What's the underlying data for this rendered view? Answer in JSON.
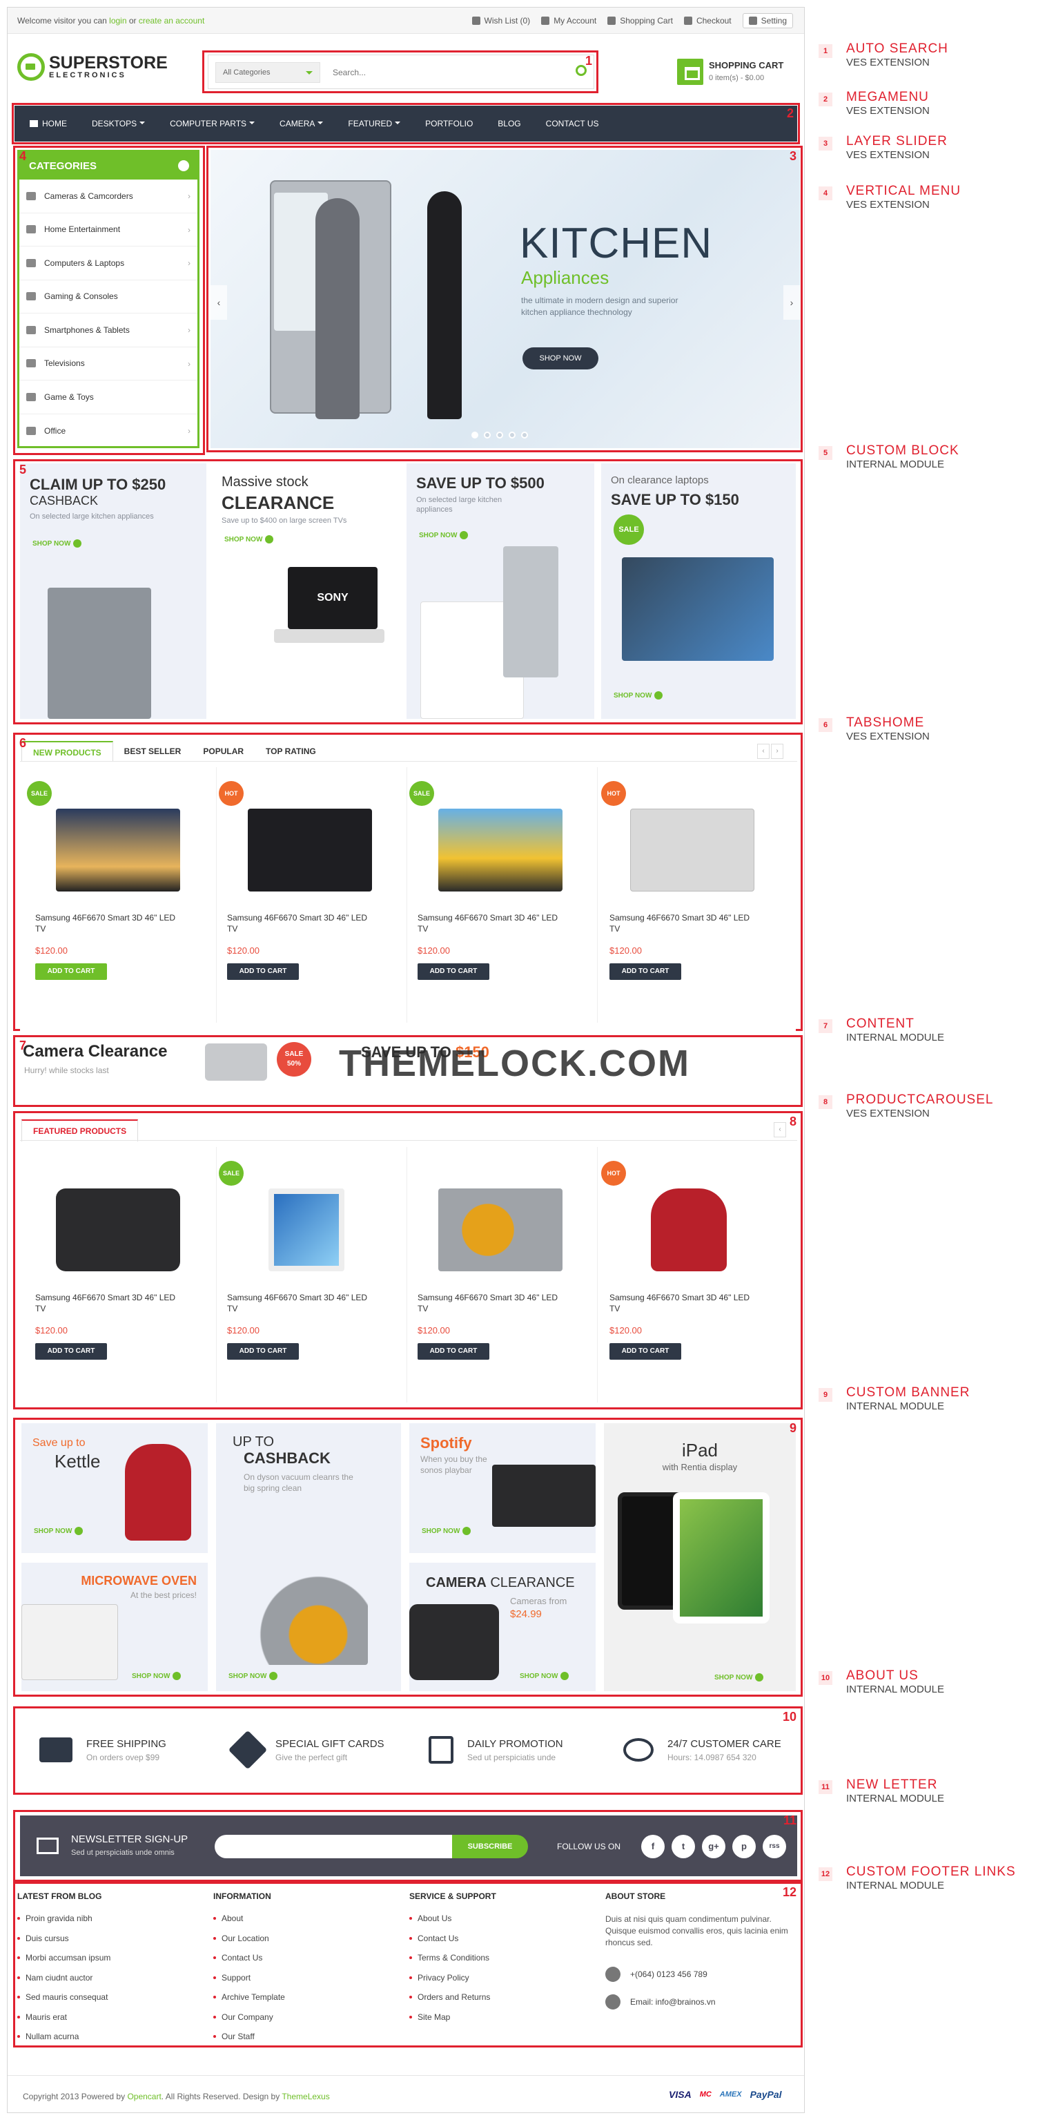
{
  "topbar": {
    "welcome_prefix": "Welcome visitor you can",
    "login": "login",
    "or": "or",
    "create": "create an account",
    "links": [
      "Wish List (0)",
      "My Account",
      "Shopping Cart",
      "Checkout"
    ],
    "setting": "Setting"
  },
  "logo": {
    "title": "SUPERSTORE",
    "subtitle": "ELECTRONICS"
  },
  "search": {
    "category": "All Categories",
    "placeholder": "Search..."
  },
  "cart": {
    "title": "SHOPPING CART",
    "summary": "0 item(s) - $0.00"
  },
  "nav": [
    "HOME",
    "DESKTOPS",
    "COMPUTER PARTS",
    "CAMERA",
    "FEATURED",
    "PORTFOLIO",
    "BLOG",
    "CONTACT US"
  ],
  "categories": {
    "title": "CATEGORIES",
    "items": [
      "Cameras & Camcorders",
      "Home Entertainment",
      "Computers & Laptops",
      "Gaming & Consoles",
      "Smartphones & Tablets",
      "Televisions",
      "Game & Toys",
      "Office"
    ]
  },
  "slider": {
    "title": "KITCHEN",
    "subtitle": "Appliances",
    "text": "the ultimate in modern design and superior kitchen appliance thechnology",
    "button": "SHOP NOW"
  },
  "custom_block": {
    "b1": {
      "line1": "CLAIM UP TO $250",
      "line2": "CASHBACK",
      "sub": "On selected large kitchen appliances",
      "shop": "SHOP NOW"
    },
    "b2": {
      "line1": "Massive stock",
      "line2": "CLEARANCE",
      "sub": "Save up to $400 on large screen TVs",
      "shop": "SHOP NOW",
      "brand": "SONY"
    },
    "b3": {
      "line1": "SAVE UP TO $500",
      "sub": "On selected large kitchen appliances",
      "shop": "SHOP NOW"
    },
    "b4": {
      "line1": "On clearance laptops",
      "line2": "SAVE UP TO $150",
      "badge": "SALE",
      "shop": "SHOP NOW"
    }
  },
  "tabs": [
    "NEW PRODUCTS",
    "BEST SELLER",
    "POPULAR",
    "TOP RATING"
  ],
  "products": [
    {
      "badge": "SALE",
      "name": "Samsung 46F6670 Smart 3D 46\" LED TV",
      "price": "$120.00",
      "button": "ADD TO CART"
    },
    {
      "badge": "HOT",
      "name": "Samsung 46F6670 Smart 3D 46\" LED TV",
      "price": "$120.00",
      "button": "ADD TO CART"
    },
    {
      "badge": "SALE",
      "name": "Samsung 46F6670 Smart 3D 46\" LED TV",
      "price": "$120.00",
      "button": "ADD TO CART"
    },
    {
      "badge": "HOT",
      "name": "Samsung 46F6670 Smart 3D 46\" LED TV",
      "price": "$120.00",
      "button": "ADD TO CART"
    }
  ],
  "content_block": {
    "title": "Camera Clearance",
    "sub": "Hurry! while stocks last",
    "sale": "SALE",
    "sale_pct": "50%",
    "save": "SAVE UP TO",
    "save_amt": "$150",
    "watermark": "THEMELOCK.COM"
  },
  "featured": {
    "tab": "FEATURED PRODUCTS",
    "items": [
      {
        "badge": "",
        "name": "Samsung 46F6670 Smart 3D 46\" LED TV",
        "price": "$120.00",
        "button": "ADD TO CART"
      },
      {
        "badge": "SALE",
        "name": "Samsung 46F6670 Smart 3D 46\" LED TV",
        "price": "$120.00",
        "button": "ADD TO CART"
      },
      {
        "badge": "",
        "name": "Samsung 46F6670 Smart 3D 46\" LED TV",
        "price": "$120.00",
        "button": "ADD TO CART"
      },
      {
        "badge": "HOT",
        "name": "Samsung 46F6670 Smart 3D 46\" LED TV",
        "price": "$120.00",
        "button": "ADD TO CART"
      }
    ]
  },
  "banners": {
    "kettle": {
      "l1": "Save up to",
      "l2": "Kettle",
      "shop": "SHOP NOW"
    },
    "microwave": {
      "l1": "MICROWAVE OVEN",
      "l2": "At the best prices!",
      "shop": "SHOP NOW"
    },
    "cashback": {
      "l1": "UP TO",
      "l2": "CASHBACK",
      "sub": "On dyson vacuum cleanrs the big spring clean",
      "shop": "SHOP NOW"
    },
    "spotify": {
      "l1": "Spotify",
      "sub": "When you buy the sonos playbar",
      "shop": "SHOP NOW"
    },
    "camera": {
      "l1": "CAMERA",
      "l2": "CLEARANCE",
      "sub": "Cameras from",
      "price": "$24.99",
      "shop": "SHOP NOW"
    },
    "ipad": {
      "l1": "iPad",
      "sub": "with Rentia display",
      "shop": "SHOP NOW"
    }
  },
  "about": [
    {
      "title": "FREE SHIPPING",
      "sub": "On orders ovep $99"
    },
    {
      "title": "SPECIAL GIFT CARDS",
      "sub": "Give the perfect gift"
    },
    {
      "title": "DAILY PROMOTION",
      "sub": "Sed ut perspiciatis unde"
    },
    {
      "title": "24/7 CUSTOMER CARE",
      "sub": "Hours: 14.0987 654 320"
    }
  ],
  "newsletter": {
    "title": "NEWSLETTER SIGN-UP",
    "sub": "Sed ut perspiciatis unde omnis",
    "button": "SUBSCRIBE",
    "follow": "FOLLOW US ON",
    "social": [
      "f",
      "t",
      "g+",
      "p",
      "rss"
    ]
  },
  "footer": {
    "blog": {
      "title": "LATEST FROM BLOG",
      "items": [
        "Proin gravida nibh",
        "Duis cursus",
        "Morbi accumsan ipsum",
        "Nam ciudnt auctor",
        "Sed mauris consequat",
        "Mauris erat",
        "Nullam acurna"
      ]
    },
    "info": {
      "title": "INFORMATION",
      "items": [
        "About",
        "Our Location",
        "Contact Us",
        "Support",
        "Archive Template",
        "Our Company",
        "Our Staff"
      ]
    },
    "service": {
      "title": "SERVICE & SUPPORT",
      "items": [
        "About Us",
        "Contact Us",
        "Terms & Conditions",
        "Privacy Policy",
        "Orders and Returns",
        "Site Map"
      ]
    },
    "store": {
      "title": "ABOUT STORE",
      "text": "Duis at nisi quis quam condimentum pulvinar. Quisque euismod convallis eros, quis lacinia enim rhoncus sed.",
      "phone": "+(064) 0123 456 789",
      "email": "Email: info@brainos.vn"
    }
  },
  "copyright": {
    "pre": "Copyright 2013 Powered by",
    "brand": "Opencart",
    "mid": ". All Rights Reserved.  Design by",
    "designer": "ThemeLexus"
  },
  "payments": [
    "VISA",
    "MC",
    "AMEX",
    "PayPal"
  ],
  "legend": [
    {
      "n": "1",
      "t": "AUTO SEARCH",
      "s": "VES EXTENSION"
    },
    {
      "n": "2",
      "t": "MEGAMENU",
      "s": "VES EXTENSION"
    },
    {
      "n": "3",
      "t": "LAYER SLIDER",
      "s": "VES EXTENSION"
    },
    {
      "n": "4",
      "t": "VERTICAL MENU",
      "s": "VES EXTENSION"
    },
    {
      "n": "5",
      "t": "CUSTOM BLOCK",
      "s": "INTERNAL MODULE"
    },
    {
      "n": "6",
      "t": "TABSHOME",
      "s": "VES EXTENSION"
    },
    {
      "n": "7",
      "t": "CONTENT",
      "s": "INTERNAL MODULE"
    },
    {
      "n": "8",
      "t": "PRODUCTCAROUSEL",
      "s": "VES EXTENSION"
    },
    {
      "n": "9",
      "t": "CUSTOM BANNER",
      "s": "INTERNAL MODULE"
    },
    {
      "n": "10",
      "t": "ABOUT US",
      "s": "INTERNAL MODULE"
    },
    {
      "n": "11",
      "t": "NEW LETTER",
      "s": "INTERNAL MODULE"
    },
    {
      "n": "12",
      "t": "CUSTOM FOOTER LINKS",
      "s": "INTERNAL MODULE"
    }
  ]
}
